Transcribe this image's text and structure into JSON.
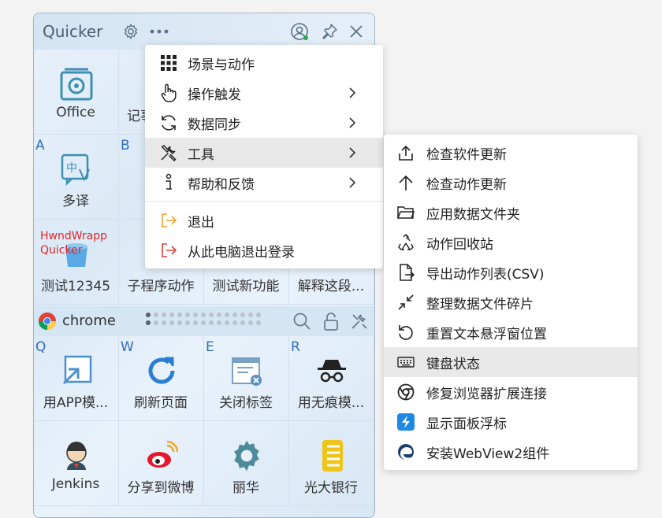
{
  "panel": {
    "title": "Quicker",
    "hwnd_text_line1": "HwndWrapp",
    "hwnd_text_line2": "Quicker"
  },
  "grid_top": [
    {
      "key": "",
      "label": "Office"
    },
    {
      "key": "",
      "label": "记事"
    },
    {
      "key": "",
      "label": ""
    },
    {
      "key": "",
      "label": ""
    }
  ],
  "grid_row2": [
    {
      "key": "A",
      "label": "多译"
    },
    {
      "key": "B",
      "label": ""
    },
    {
      "key": "",
      "label": ""
    },
    {
      "key": "",
      "label": ""
    }
  ],
  "grid_row3": [
    {
      "key": "",
      "label": "测试12345"
    },
    {
      "key": "",
      "label": "子程序动作"
    },
    {
      "key": "",
      "label": "测试新功能"
    },
    {
      "key": "",
      "label": "解释这段..."
    }
  ],
  "chromebar": {
    "label": "chrome"
  },
  "grid_row4": [
    {
      "key": "Q",
      "label": "用APP模..."
    },
    {
      "key": "W",
      "label": "刷新页面"
    },
    {
      "key": "E",
      "label": "关闭标签"
    },
    {
      "key": "R",
      "label": "用无痕模..."
    }
  ],
  "grid_row5": [
    {
      "key": "",
      "label": "Jenkins"
    },
    {
      "key": "",
      "label": "分享到微博"
    },
    {
      "key": "",
      "label": "丽华"
    },
    {
      "key": "",
      "label": "光大银行"
    }
  ],
  "menu": {
    "items": [
      {
        "label": "场景与动作",
        "icon": "grid-icon"
      },
      {
        "label": "操作触发",
        "icon": "hand-icon"
      },
      {
        "label": "数据同步",
        "icon": "sync-icon"
      },
      {
        "label": "工具",
        "icon": "tools-icon"
      },
      {
        "label": "帮助和反馈",
        "icon": "help-icon"
      },
      {
        "label": "退出",
        "icon": "exit-icon"
      },
      {
        "label": "从此电脑退出登录",
        "icon": "logout-icon"
      }
    ]
  },
  "submenu": {
    "items": [
      {
        "label": "检查软件更新",
        "icon": "upload-icon"
      },
      {
        "label": "检查动作更新",
        "icon": "arrow-up-icon"
      },
      {
        "label": "应用数据文件夹",
        "icon": "folder-icon"
      },
      {
        "label": "动作回收站",
        "icon": "recycle-icon"
      },
      {
        "label": "导出动作列表(CSV)",
        "icon": "export-icon"
      },
      {
        "label": "整理数据文件碎片",
        "icon": "compress-icon"
      },
      {
        "label": "重置文本悬浮窗位置",
        "icon": "reset-icon"
      },
      {
        "label": "键盘状态",
        "icon": "keyboard-icon"
      },
      {
        "label": "修复浏览器扩展连接",
        "icon": "chrome-icon"
      },
      {
        "label": "显示面板浮标",
        "icon": "quicker-icon"
      },
      {
        "label": "安装WebView2组件",
        "icon": "edge-icon"
      }
    ]
  },
  "colors": {
    "accent": "#2f6fba",
    "highlight": "#e8e8e8",
    "exit_orange": "#f0a030",
    "logout_red": "#e04040"
  }
}
